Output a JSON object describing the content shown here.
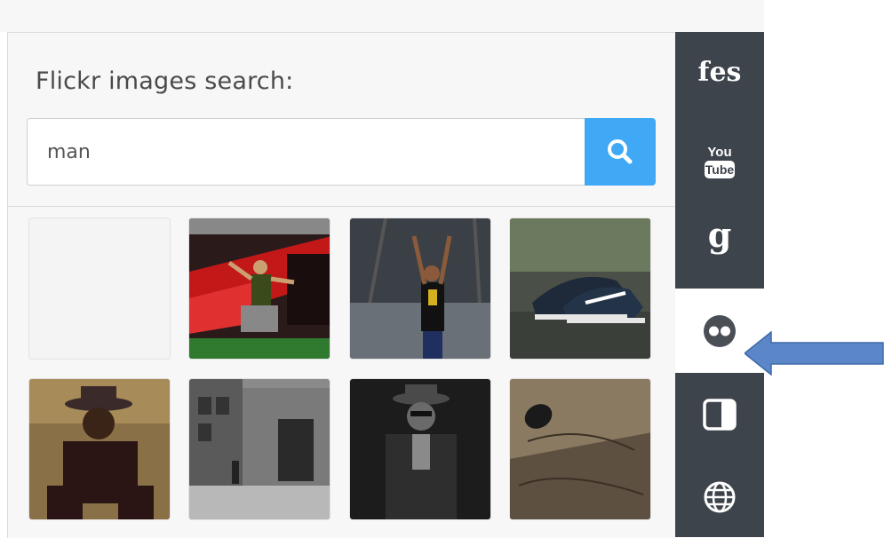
{
  "panel": {
    "title": "Flickr images search:",
    "search_value": "man"
  },
  "sidebar": {
    "items": [
      {
        "label": "fes",
        "icon": "fes-logo-icon"
      },
      {
        "label": "You Tube",
        "icon": "youtube-icon"
      },
      {
        "label": "g",
        "icon": "google-icon"
      },
      {
        "label": "",
        "icon": "flickr-icon",
        "active": true
      },
      {
        "label": "",
        "icon": "split-panel-icon"
      },
      {
        "label": "",
        "icon": "globe-icon"
      }
    ]
  },
  "thumbnails": [
    {
      "name": "empty"
    },
    {
      "name": "performer-on-stage-red"
    },
    {
      "name": "performer-on-stage-arms-up"
    },
    {
      "name": "sneakers-on-ground"
    },
    {
      "name": "man-in-hat-crouching"
    },
    {
      "name": "street-black-white"
    },
    {
      "name": "man-in-hat-portrait"
    },
    {
      "name": "rock-texture"
    }
  ],
  "colors": {
    "accent": "#3fa9f5",
    "sidebar": "#3d444b",
    "arrow": "#5b87c9"
  }
}
